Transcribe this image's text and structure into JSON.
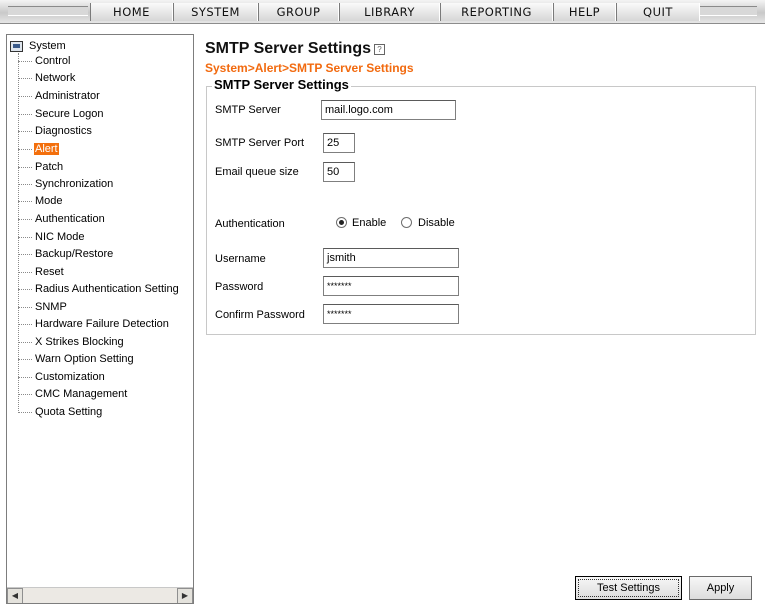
{
  "menu": {
    "items": [
      "HOME",
      "SYSTEM",
      "GROUP",
      "LIBRARY",
      "REPORTING",
      "HELP",
      "QUIT"
    ]
  },
  "sidebar": {
    "root_label": "System",
    "items": [
      "Control",
      "Network",
      "Administrator",
      "Secure Logon",
      "Diagnostics",
      "Alert",
      "Patch",
      "Synchronization",
      "Mode",
      "Authentication",
      "NIC Mode",
      "Backup/Restore",
      "Reset",
      "Radius Authentication Setting",
      "SNMP",
      "Hardware Failure Detection",
      "X Strikes Blocking",
      "Warn Option Setting",
      "Customization",
      "CMC Management",
      "Quota Setting"
    ],
    "active_item": "Alert"
  },
  "page": {
    "title": "SMTP Server Settings",
    "breadcrumb": "System>Alert>SMTP Server Settings",
    "section_title": "SMTP Server Settings"
  },
  "form": {
    "smtp_server": {
      "label": "SMTP Server",
      "value": "mail.logo.com"
    },
    "smtp_port": {
      "label": "SMTP Server Port",
      "value": "25"
    },
    "queue_size": {
      "label": "Email queue size",
      "value": "50"
    },
    "authentication": {
      "label": "Authentication",
      "enable_label": "Enable",
      "disable_label": "Disable",
      "selected": "Enable"
    },
    "username": {
      "label": "Username",
      "value": "jsmith"
    },
    "password": {
      "label": "Password",
      "value": "*******"
    },
    "confirm_password": {
      "label": "Confirm Password",
      "value": "*******"
    }
  },
  "buttons": {
    "test_settings": "Test Settings",
    "apply": "Apply"
  },
  "colors": {
    "accent": "#f26a0f",
    "active_nav_bg": "#f36f0c"
  }
}
